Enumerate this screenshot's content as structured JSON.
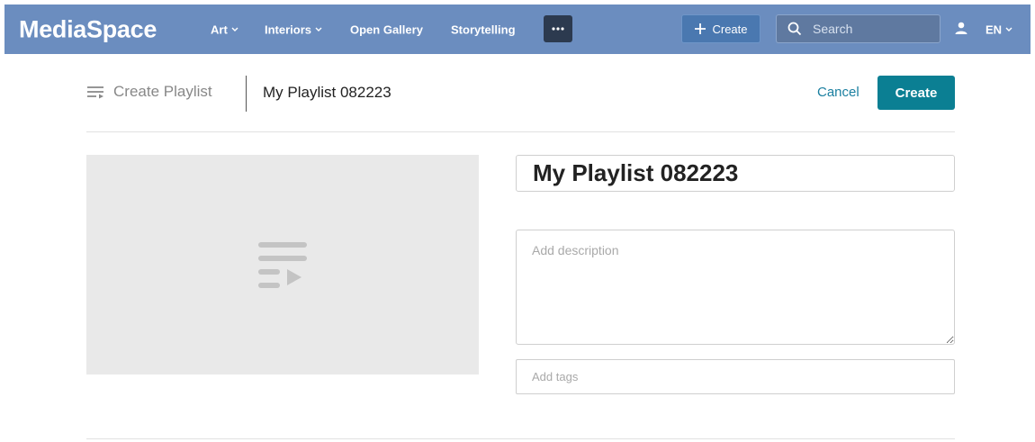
{
  "header": {
    "logo": "MediaSpace",
    "nav": [
      {
        "label": "Art",
        "has_dropdown": true
      },
      {
        "label": "Interiors",
        "has_dropdown": true
      },
      {
        "label": "Open Gallery",
        "has_dropdown": false
      },
      {
        "label": "Storytelling",
        "has_dropdown": false
      }
    ],
    "more_icon": "ellipsis-icon",
    "create_label": "Create",
    "search_placeholder": "Search",
    "language": "EN",
    "bg_color": "#6b8dbf"
  },
  "page": {
    "breadcrumb_label": "Create Playlist",
    "playlist_title": "My Playlist 082223",
    "cancel_label": "Cancel",
    "create_label": "Create",
    "accent_color": "#0b7f93"
  },
  "form": {
    "title_value": "My Playlist 082223",
    "description_placeholder": "Add description",
    "tags_placeholder": "Add tags",
    "thumbnail_icon": "playlist-icon"
  }
}
